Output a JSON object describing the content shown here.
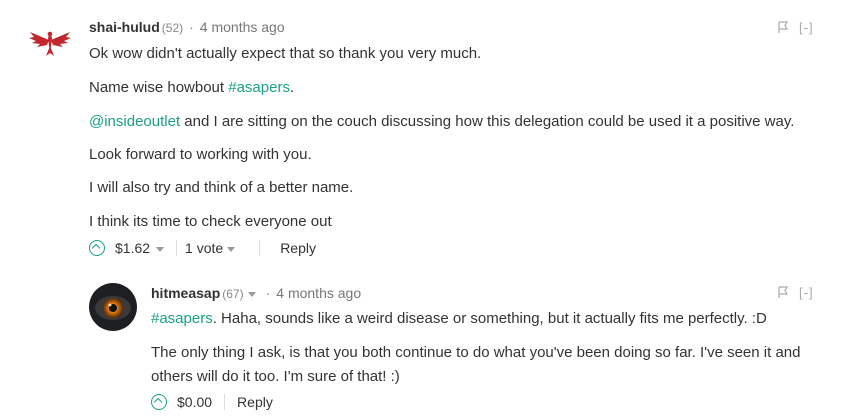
{
  "comments": [
    {
      "author": "shai-hulud",
      "reputation": "(52)",
      "separator": "·",
      "timestamp": "4 months ago",
      "tool_flag_icon": "flag-icon",
      "tool_collapse": "[-]",
      "paragraphs": [
        {
          "text": "Ok wow didn't actually expect that so thank you very much."
        },
        {
          "before": "Name wise howbout ",
          "tag": "#asapers",
          "after": "."
        },
        {
          "mention": "@insideoutlet",
          "after": " and I are sitting on the couch discussing how this delegation could be used it a positive way."
        },
        {
          "text": "Look forward to working with you."
        },
        {
          "text": "I will also try and think of a better name."
        },
        {
          "text": "I think its time to check everyone out"
        }
      ],
      "payout": "$1.62",
      "votes": "1 vote",
      "reply_label": "Reply"
    },
    {
      "author": "hitmeasap",
      "reputation": "(67)",
      "separator": "·",
      "timestamp": "4 months ago",
      "tool_flag_icon": "flag-icon",
      "tool_collapse": "[-]",
      "paragraphs": [
        {
          "tag": "#asapers",
          "after": ". Haha, sounds like a weird disease or something, but it actually fits me perfectly. :D"
        },
        {
          "text": "The only thing I ask, is that you both continue to do what you've been doing so far. I've seen it and"
        },
        {
          "text": "others will do it too. I'm sure of that! :)"
        }
      ],
      "payout": "$0.00",
      "reply_label": "Reply"
    }
  ],
  "colors": {
    "accent": "#1aa187",
    "text": "#333333",
    "muted": "#777777",
    "avatar_red": "#c0282d"
  },
  "icons": [
    "phoenix-avatar-icon",
    "eye-avatar-icon",
    "upvote-icon",
    "flag-icon",
    "chevron-down-icon"
  ]
}
